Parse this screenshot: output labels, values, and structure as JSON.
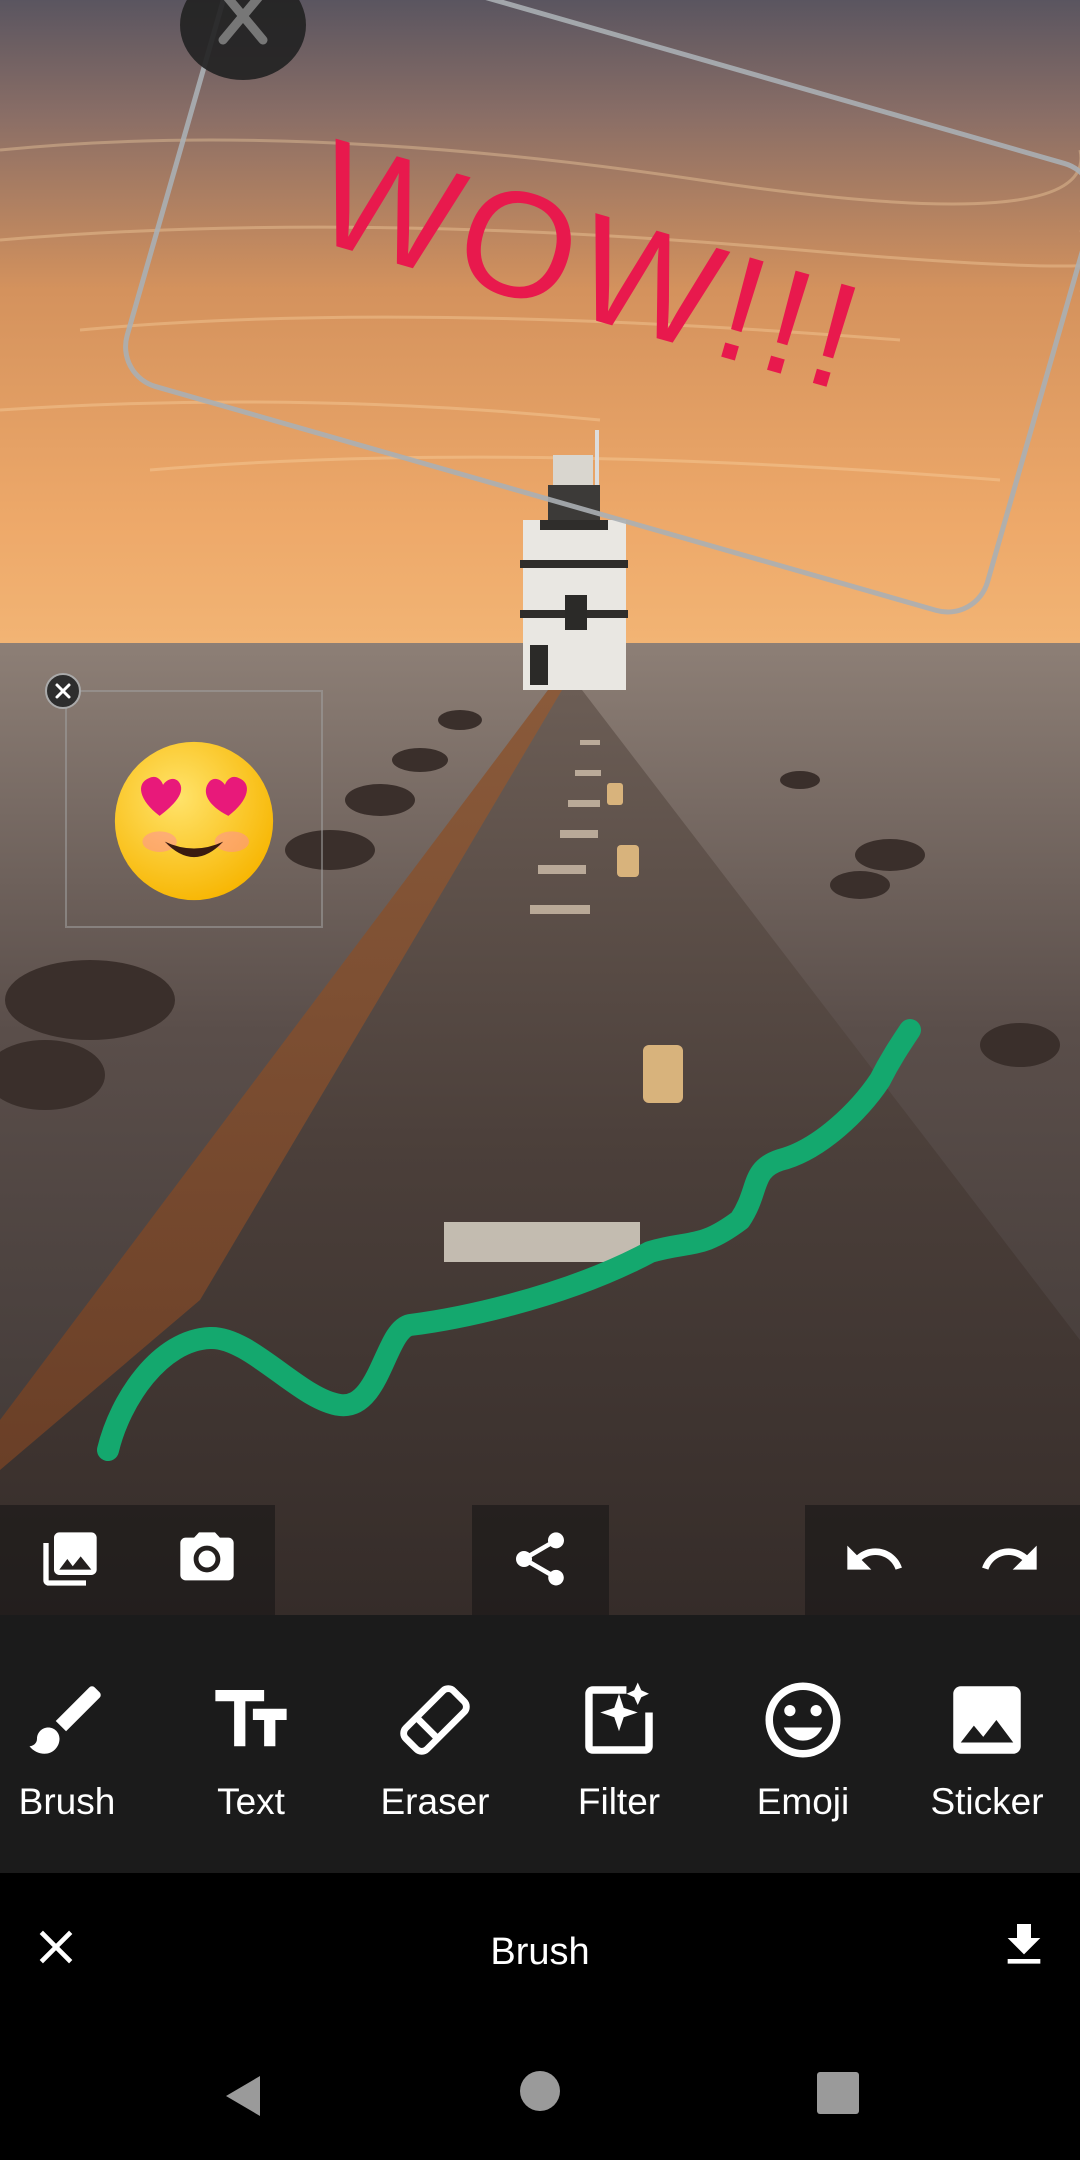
{
  "canvas": {
    "text_sticker": {
      "text": "WOW!!!",
      "color": "#e8194d"
    },
    "emoji_sticker": {
      "emoji": "heart-eyes-face"
    },
    "brush_stroke_color": "#14a86e"
  },
  "quick_actions": {
    "left": [
      "gallery-icon",
      "camera-icon"
    ],
    "middle": [
      "share-icon"
    ],
    "right": [
      "undo-icon",
      "redo-icon"
    ]
  },
  "tools": [
    {
      "label": "Brush",
      "icon": "brush-icon"
    },
    {
      "label": "Text",
      "icon": "text-icon"
    },
    {
      "label": "Eraser",
      "icon": "eraser-icon"
    },
    {
      "label": "Filter",
      "icon": "filter-icon"
    },
    {
      "label": "Emoji",
      "icon": "emoji-icon"
    },
    {
      "label": "Sticker",
      "icon": "sticker-icon"
    }
  ],
  "editbar": {
    "title": "Brush",
    "close_icon": "close-icon",
    "save_icon": "download-icon"
  },
  "navbar": {
    "back": "back-icon",
    "home": "home-icon",
    "recents": "recents-icon"
  }
}
